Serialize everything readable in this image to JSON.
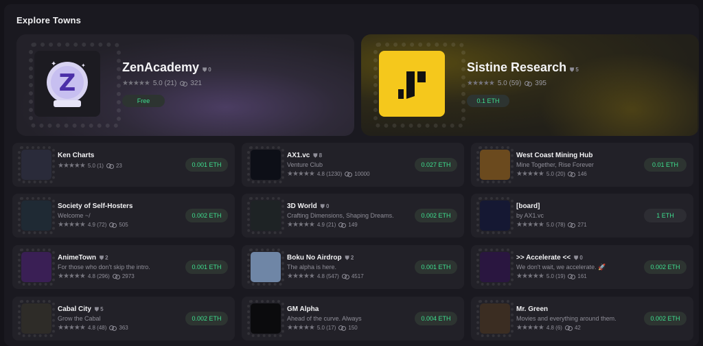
{
  "section_title": "Explore Towns",
  "featured": [
    {
      "name": "ZenAcademy",
      "count": "0",
      "rating": "5.0 (21)",
      "members": "321",
      "price": "Free",
      "logo_color": "#1c1b21"
    },
    {
      "name": "Sistine Research",
      "count": "5",
      "rating": "5.0 (59)",
      "members": "395",
      "price": "0.1 ETH",
      "logo_color": "#f5c81c"
    }
  ],
  "towns": [
    {
      "name": "Ken Charts",
      "count": "",
      "desc": "",
      "rating": "5.0 (1)",
      "members": "23",
      "price": "0.001 ETH",
      "thumb": "#2a2b3a"
    },
    {
      "name": "AX1.vc",
      "count": "8",
      "desc": "Venture Club",
      "rating": "4.8 (1230)",
      "members": "10000",
      "price": "0.027 ETH",
      "thumb": "#0d0f17"
    },
    {
      "name": "West Coast Mining Hub",
      "count": "",
      "desc": "Mine Together, Rise Forever",
      "rating": "5.0 (20)",
      "members": "146",
      "price": "0.01 ETH",
      "thumb": "#6b4a1e"
    },
    {
      "name": "Society of Self-Hosters",
      "count": "",
      "desc": "Welcome ~/",
      "rating": "4.9 (72)",
      "members": "505",
      "price": "0.002 ETH",
      "thumb": "#1f2a34"
    },
    {
      "name": "3D World",
      "count": "0",
      "desc": "Crafting Dimensions, Shaping Dreams.",
      "rating": "4.9 (21)",
      "members": "149",
      "price": "0.002 ETH",
      "thumb": "#1e2325"
    },
    {
      "name": "[board]",
      "count": "",
      "desc": "by AX1.vc",
      "rating": "5.0 (78)",
      "members": "271",
      "price": "1 ETH",
      "thumb": "#151833"
    },
    {
      "name": "AnimeTown",
      "count": "2",
      "desc": "For those who don't skip the intro.",
      "rating": "4.8 (296)",
      "members": "2973",
      "price": "0.001 ETH",
      "thumb": "#3a1f55"
    },
    {
      "name": "Boku No Airdrop",
      "count": "2",
      "desc": "The alpha is here.",
      "rating": "4.8 (547)",
      "members": "4517",
      "price": "0.001 ETH",
      "thumb": "#6f86a6"
    },
    {
      "name": ">> Accelerate <<",
      "count": "0",
      "desc": "We don't wait, we accelerate. 🚀",
      "rating": "5.0 (19)",
      "members": "161",
      "price": "0.002 ETH",
      "thumb": "#2a1640"
    },
    {
      "name": "Cabal City",
      "count": "5",
      "desc": "Grow the Cabal",
      "rating": "4.8 (48)",
      "members": "363",
      "price": "0.002 ETH",
      "thumb": "#2e2c28"
    },
    {
      "name": "GM Alpha",
      "count": "",
      "desc": "Ahead of the curve. Always",
      "rating": "5.0 (17)",
      "members": "150",
      "price": "0.004 ETH",
      "thumb": "#0b0b0d"
    },
    {
      "name": "Mr. Green",
      "count": "",
      "desc": "Movies and everything around them.",
      "rating": "4.8 (6)",
      "members": "42",
      "price": "0.002 ETH",
      "thumb": "#3b2d22"
    }
  ],
  "colors": {
    "accent_green": "#3ee08f",
    "card_bg": "#222128",
    "page_bg": "#141319"
  }
}
